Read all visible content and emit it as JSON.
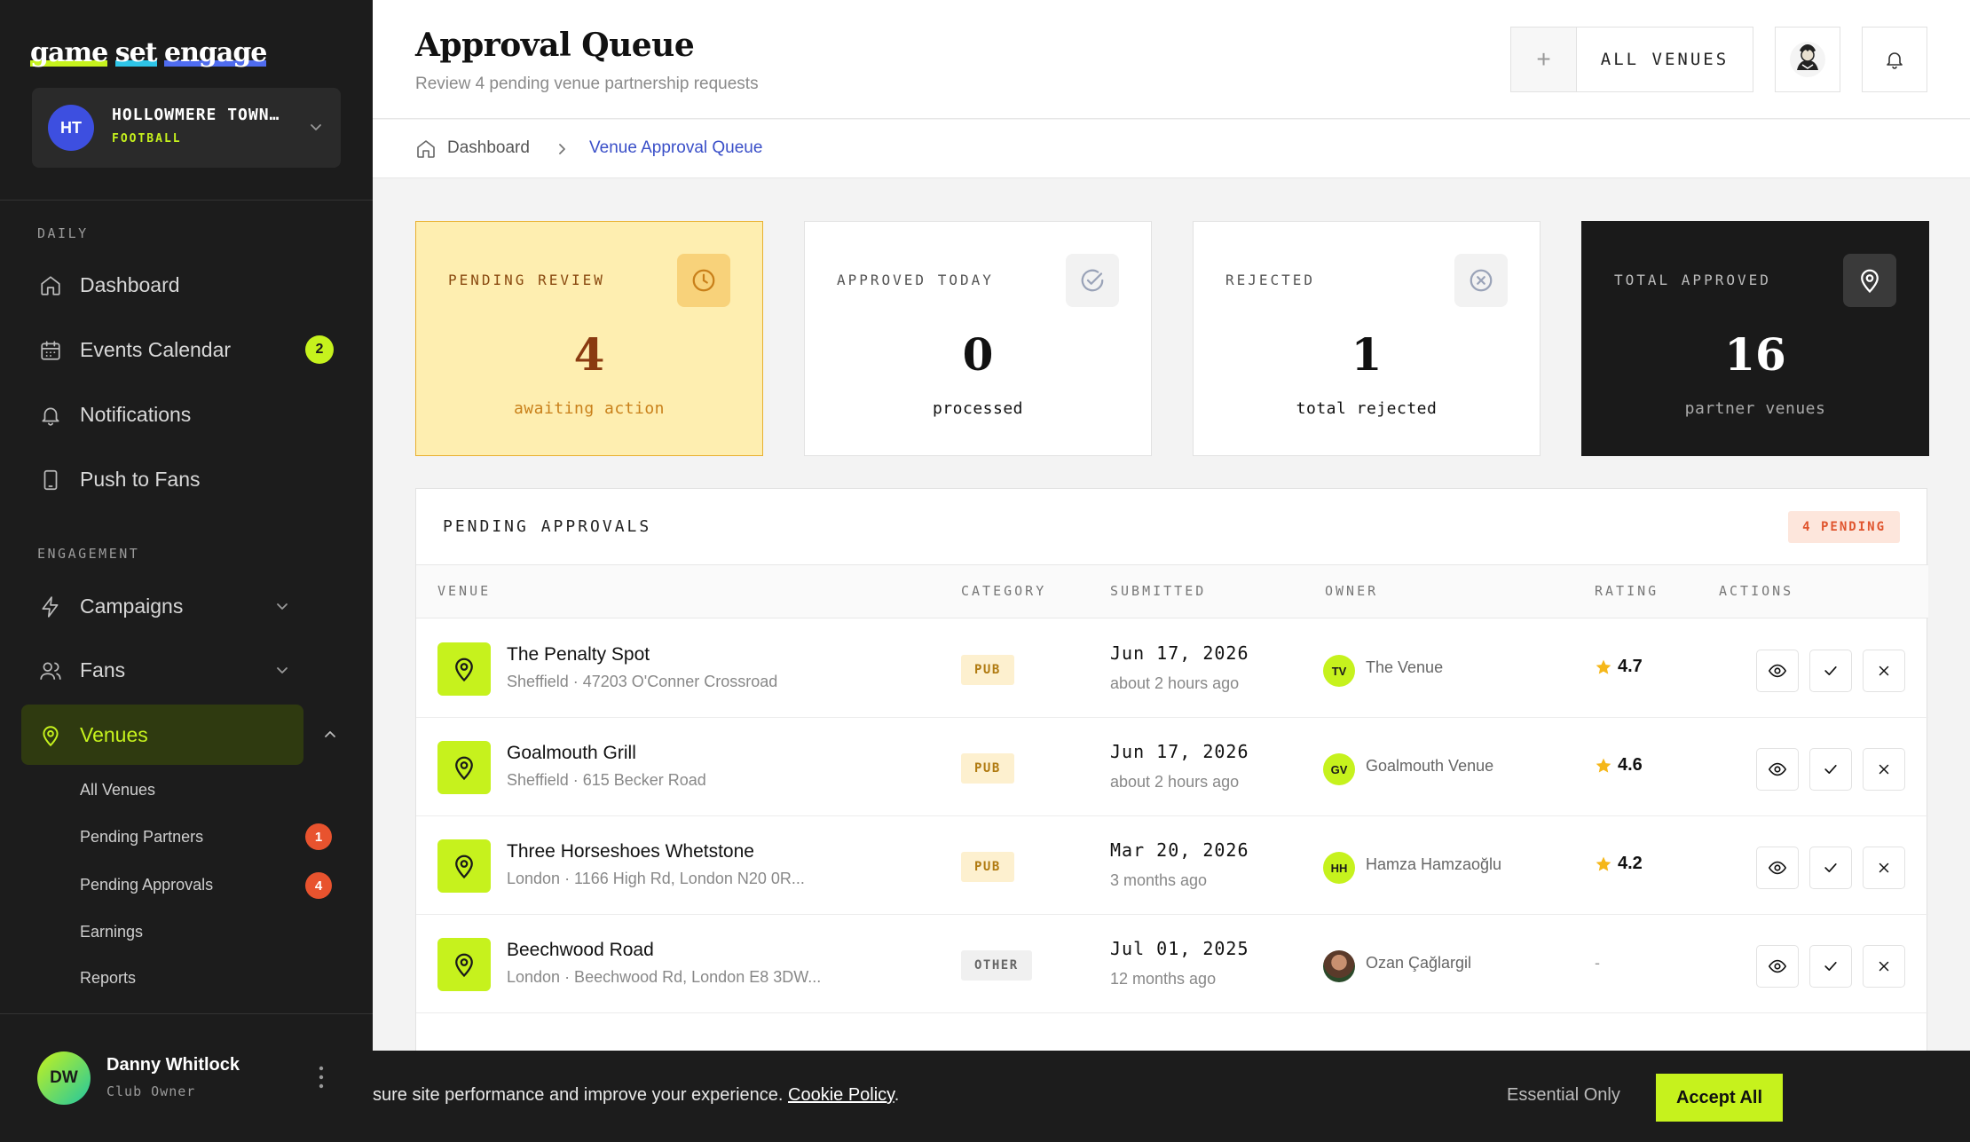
{
  "brand": {
    "words": [
      "game",
      "set",
      "engage"
    ]
  },
  "club": {
    "initials": "HT",
    "name": "HOLLOWMERE TOWN…",
    "sport": "FOOTBALL"
  },
  "sidebar": {
    "daily_label": "DAILY",
    "engagement_label": "ENGAGEMENT",
    "daily_items": [
      {
        "label": "Dashboard",
        "icon": "home-icon"
      },
      {
        "label": "Events Calendar",
        "icon": "calendar-icon",
        "badge": "2"
      },
      {
        "label": "Notifications",
        "icon": "bell-icon"
      },
      {
        "label": "Push to Fans",
        "icon": "phone-icon"
      }
    ],
    "engagement_items": [
      {
        "label": "Campaigns",
        "icon": "lightning-icon"
      },
      {
        "label": "Fans",
        "icon": "users-icon"
      },
      {
        "label": "Venues",
        "icon": "map-pin-icon"
      }
    ],
    "venue_sub_items": [
      {
        "label": "All Venues"
      },
      {
        "label": "Pending Partners",
        "badge": "1"
      },
      {
        "label": "Pending Approvals",
        "badge": "4"
      },
      {
        "label": "Earnings"
      },
      {
        "label": "Reports"
      }
    ]
  },
  "user": {
    "initials": "DW",
    "name": "Danny Whitlock",
    "role": "Club Owner"
  },
  "header": {
    "title": "Approval Queue",
    "subtitle": "Review 4 pending venue partnership requests",
    "venue_filter": "ALL VENUES"
  },
  "breadcrumb": {
    "home": "Dashboard",
    "current": "Venue Approval Queue"
  },
  "stats": [
    {
      "label": "PENDING REVIEW",
      "value": "4",
      "caption": "awaiting action",
      "icon": "clock-icon"
    },
    {
      "label": "APPROVED TODAY",
      "value": "0",
      "caption": "processed",
      "icon": "check-circle-icon"
    },
    {
      "label": "REJECTED",
      "value": "1",
      "caption": "total rejected",
      "icon": "x-circle-icon"
    },
    {
      "label": "TOTAL APPROVED",
      "value": "16",
      "caption": "partner venues",
      "icon": "map-pin-icon"
    }
  ],
  "table": {
    "title": "PENDING APPROVALS",
    "pending_badge": "4 PENDING",
    "columns": [
      "VENUE",
      "CATEGORY",
      "SUBMITTED",
      "OWNER",
      "RATING",
      "ACTIONS"
    ],
    "rows": [
      {
        "name": "The Penalty Spot",
        "address": "Sheffield · 47203 O'Conner Crossroad",
        "category": "PUB",
        "date": "Jun 17, 2026",
        "relative": "about 2 hours ago",
        "owner_initials": "TV",
        "owner": "The Venue",
        "rating": "4.7"
      },
      {
        "name": "Goalmouth Grill",
        "address": "Sheffield · 615 Becker Road",
        "category": "PUB",
        "date": "Jun 17, 2026",
        "relative": "about 2 hours ago",
        "owner_initials": "GV",
        "owner": "Goalmouth Venue",
        "rating": "4.6"
      },
      {
        "name": "Three Horseshoes Whetstone",
        "address": "London · 1166 High Rd, London N20 0R...",
        "category": "PUB",
        "date": "Mar 20, 2026",
        "relative": "3 months ago",
        "owner_initials": "HH",
        "owner": "Hamza Hamzaoğlu",
        "rating": "4.2"
      },
      {
        "name": "Beechwood Road",
        "address": "London · Beechwood Rd, London E8 3DW...",
        "category": "OTHER",
        "date": "Jul 01, 2025",
        "relative": "12 months ago",
        "owner_initials": "",
        "owner": "Ozan Çağlargil",
        "rating": "-"
      }
    ]
  },
  "cookie": {
    "text": "sure site performance and improve your experience.",
    "policy_link": "Cookie Policy",
    "essential": "Essential Only",
    "accept": "Accept All"
  },
  "colors": {
    "accent": "#c6f21d",
    "sidebar_bg": "#1c1c1c",
    "pending_bg": "#feeeb0",
    "badge_orange": "#e8532e",
    "link_blue": "#3a4fc8"
  }
}
